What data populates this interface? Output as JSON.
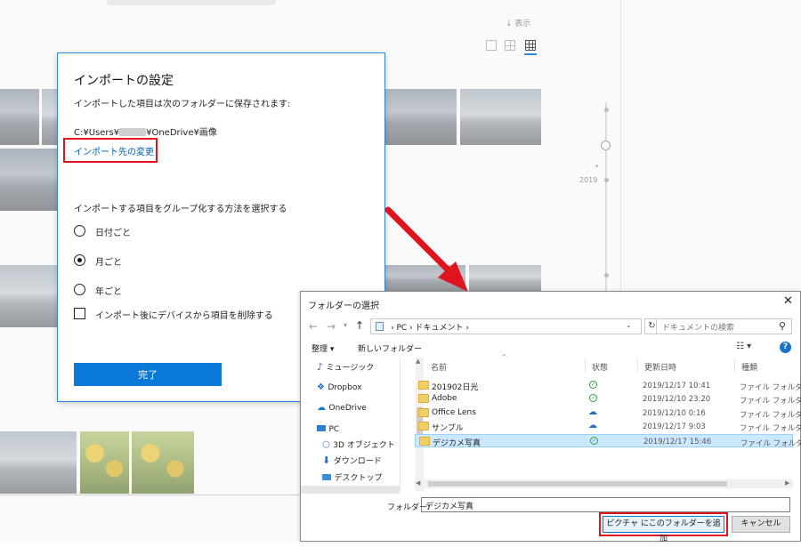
{
  "background": {
    "sort_label": "表示",
    "timeline_year": "2019",
    "icons": [
      "sort-arrow-icon",
      "single-view-icon",
      "medium-grid-icon",
      "large-grid-icon"
    ]
  },
  "import_panel": {
    "title": "インポートの設定",
    "description": "インポートした項目は次のフォルダーに保存されます:",
    "path_prefix": "C:¥Users¥",
    "path_suffix": "¥OneDrive¥画像",
    "change_link": "インポート先の変更",
    "group_title": "インポートする項目をグループ化する方法を選択する",
    "options": [
      {
        "label": "日付ごと",
        "selected": false
      },
      {
        "label": "月ごと",
        "selected": true
      },
      {
        "label": "年ごと",
        "selected": false
      }
    ],
    "delete_checkbox": {
      "label": "インポート後にデバイスから項目を削除する",
      "checked": false
    },
    "done_button": "完了"
  },
  "folder_dialog": {
    "title": "フォルダーの選択",
    "address": [
      "PC",
      "ドキュメント"
    ],
    "search_placeholder": "ドキュメントの検索",
    "toolbar": {
      "organize": "整理 ▾",
      "new_folder": "新しいフォルダー"
    },
    "nav_items": [
      {
        "label": "ミュージック",
        "icon": "music-note-icon"
      },
      {
        "label": "Dropbox",
        "icon": "dropbox-icon"
      },
      {
        "label": "OneDrive",
        "icon": "onedrive-cloud-icon"
      },
      {
        "label": "PC",
        "icon": "pc-icon"
      },
      {
        "label": "3D オブジェクト",
        "icon": "3d-objects-icon"
      },
      {
        "label": "ダウンロード",
        "icon": "download-icon"
      },
      {
        "label": "デスクトップ",
        "icon": "desktop-icon"
      }
    ],
    "columns": [
      "名前",
      "状態",
      "更新日時",
      "種類"
    ],
    "rows": [
      {
        "name": "201902日光",
        "status": "synced",
        "date": "2019/12/17 10:41",
        "type": "ファイル フォルダー",
        "selected": false
      },
      {
        "name": "Adobe",
        "status": "synced",
        "date": "2019/12/10 23:20",
        "type": "ファイル フォルダー",
        "selected": false
      },
      {
        "name": "Office Lens",
        "status": "cloud",
        "date": "2019/12/10 0:16",
        "type": "ファイル フォルダー",
        "selected": false
      },
      {
        "name": "サンプル",
        "status": "cloud",
        "date": "2019/12/17 9:03",
        "type": "ファイル フォルダー",
        "selected": false
      },
      {
        "name": "デジカメ写真",
        "status": "synced",
        "date": "2019/12/17 15:46",
        "type": "ファイル フォルダー",
        "selected": true
      }
    ],
    "folder_label": "フォルダー:",
    "folder_value": "デジカメ写真",
    "add_button": "ピクチャ にこのフォルダーを追加",
    "cancel_button": "キャンセル"
  },
  "colors": {
    "accent": "#0a78d7",
    "highlight": "#e0141e",
    "selection": "#cce8ff"
  }
}
